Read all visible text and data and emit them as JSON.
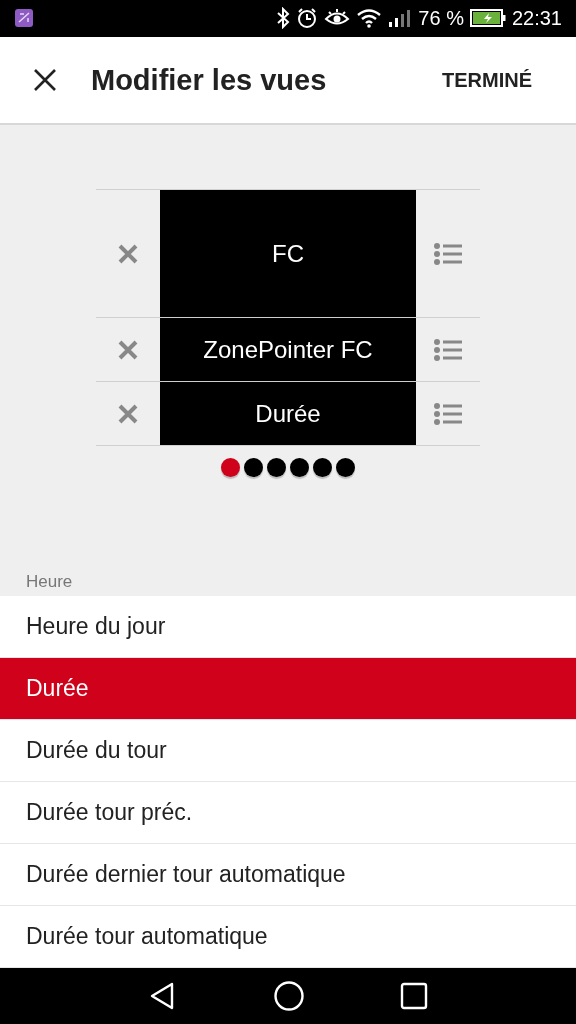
{
  "status_bar": {
    "battery": "76 %",
    "time": "22:31"
  },
  "header": {
    "title": "Modifier les vues",
    "action": "TERMINÉ"
  },
  "fields": [
    {
      "label": "FC",
      "large": true
    },
    {
      "label": "ZonePointer FC",
      "large": false
    },
    {
      "label": "Durée",
      "large": false
    }
  ],
  "pages": [
    {
      "selected": true
    },
    {
      "selected": false
    },
    {
      "selected": false
    },
    {
      "selected": false
    },
    {
      "selected": false
    },
    {
      "selected": false
    }
  ],
  "section": "Heure",
  "items": [
    {
      "label": "Heure du jour",
      "selected": false
    },
    {
      "label": "Durée",
      "selected": true
    },
    {
      "label": "Durée du tour",
      "selected": false
    },
    {
      "label": "Durée tour préc.",
      "selected": false
    },
    {
      "label": "Durée dernier tour automatique",
      "selected": false
    },
    {
      "label": "Durée tour automatique",
      "selected": false
    }
  ]
}
